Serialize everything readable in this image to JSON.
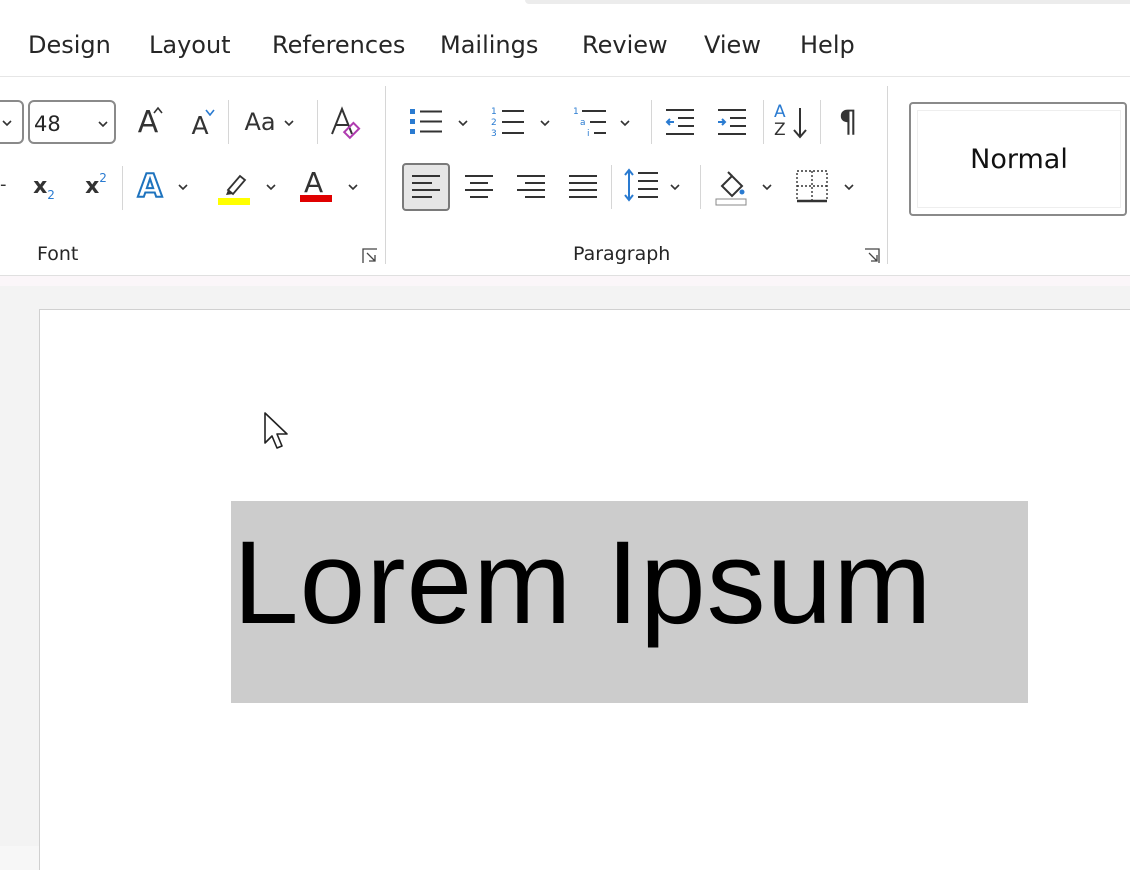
{
  "menu": {
    "tabs": [
      "Design",
      "Layout",
      "References",
      "Mailings",
      "Review",
      "View",
      "Help"
    ]
  },
  "font_group": {
    "label": "Font",
    "font_size": "48",
    "change_case_label": "Aa",
    "grow_label": "A",
    "shrink_label": "A",
    "text_effects_label": "A",
    "font_color_label": "A",
    "highlight_color": "#ffff00",
    "font_color": "#e00000",
    "subscript_label": "x",
    "subscript_sub": "2",
    "superscript_label": "x",
    "superscript_sup": "2"
  },
  "paragraph_group": {
    "label": "Paragraph",
    "sort_top": "A",
    "sort_bottom": "Z",
    "pilcrow": "¶"
  },
  "styles": {
    "normal_label": "Normal"
  },
  "document": {
    "text": "Lorem Ipsum"
  },
  "colors": {
    "accent_blue": "#1e73be",
    "selection": "#cccccc"
  }
}
